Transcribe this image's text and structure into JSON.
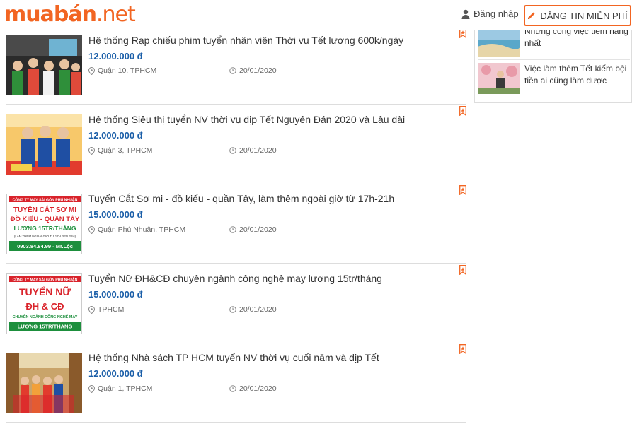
{
  "header": {
    "logo_main": "muabán",
    "logo_tld": ".net",
    "login_label": "Đăng nhập",
    "post_button_label": "ĐĂNG TIN MIỄN PHÍ"
  },
  "colors": {
    "brand_orange": "#f26522",
    "price_blue": "#1a5ea8",
    "poster_red": "#d9232b",
    "poster_green": "#1d8f3d"
  },
  "icons": {
    "login": "user-icon",
    "post": "pencil-icon",
    "location": "map-pin-icon",
    "date": "clock-icon",
    "save": "bookmark-icon"
  },
  "listings": [
    {
      "title": "Hệ thống Rạp chiếu phim tuyển nhân viên Thời vụ Tết lương 600k/ngày",
      "price": "12.000.000 đ",
      "location": "Quận 10, TPHCM",
      "date": "20/01/2020"
    },
    {
      "title": "Hệ thống Siêu thị tuyển NV thời vụ dịp Tết Nguyên Đán 2020 và Lâu dài",
      "price": "12.000.000 đ",
      "location": "Quận 3, TPHCM",
      "date": "20/01/2020"
    },
    {
      "title": "Tuyển Cắt Sơ mi - đồ kiểu - quần Tây, làm thêm ngoài giờ từ 17h-21h",
      "price": "15.000.000 đ",
      "location": "Quận Phú Nhuận, TPHCM",
      "date": "20/01/2020"
    },
    {
      "title": "Tuyển Nữ ĐH&CĐ chuyên ngành công nghệ may lương 15tr/tháng",
      "price": "15.000.000 đ",
      "location": "TPHCM",
      "date": "20/01/2020"
    },
    {
      "title": "Hệ thống Nhà sách TP HCM tuyển NV thời vụ cuối năm và dịp Tết",
      "price": "12.000.000 đ",
      "location": "Quận 1, TPHCM",
      "date": "20/01/2020"
    }
  ],
  "posters": {
    "p3": {
      "company": "CÔNG TY MAY SÀI GÒN PHÚ NHUẬN",
      "line1": "TUYỂN CẮT SƠ MI",
      "line2": "ĐỒ KIỂU - QUẦN TÂY",
      "salary": "LƯƠNG 15TR/THÁNG",
      "note": "(LÀM THÊM NGOÀI GIỜ TỪ 17H ĐẾN 21H)",
      "phone": "0903.84.84.99 - Mr.Lộc"
    },
    "p4": {
      "company": "CÔNG TY MAY SÀI GÒN PHÚ NHUẬN",
      "line1": "TUYỂN NỮ",
      "line2": "ĐH & CĐ",
      "sub": "CHUYÊN NGÀNH CÔNG NGHỆ MAY",
      "salary": "LƯƠNG 15TR/THÁNG"
    }
  },
  "sidebar": {
    "items": [
      {
        "title": "Những công việc tiềm năng nhất"
      },
      {
        "title": "Việc làm thêm Tết kiếm bội tiền ai cũng làm được"
      }
    ]
  }
}
